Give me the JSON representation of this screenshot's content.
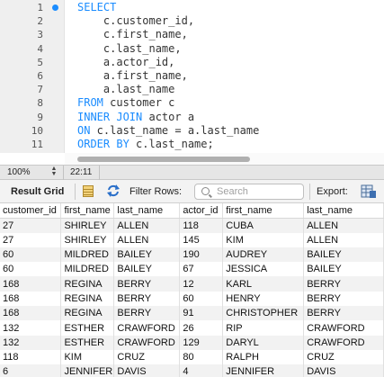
{
  "editor": {
    "lines": [
      {
        "num": "1",
        "segments": [
          {
            "text": "SELECT",
            "kw": true
          }
        ]
      },
      {
        "num": "2",
        "segments": [
          {
            "text": "    c.customer_id,",
            "kw": false
          }
        ]
      },
      {
        "num": "3",
        "segments": [
          {
            "text": "    c.first_name,",
            "kw": false
          }
        ]
      },
      {
        "num": "4",
        "segments": [
          {
            "text": "    c.last_name,",
            "kw": false
          }
        ]
      },
      {
        "num": "5",
        "segments": [
          {
            "text": "    a.actor_id,",
            "kw": false
          }
        ]
      },
      {
        "num": "6",
        "segments": [
          {
            "text": "    a.first_name,",
            "kw": false
          }
        ]
      },
      {
        "num": "7",
        "segments": [
          {
            "text": "    a.last_name",
            "kw": false
          }
        ]
      },
      {
        "num": "8",
        "segments": [
          {
            "text": "FROM",
            "kw": true
          },
          {
            "text": " customer c",
            "kw": false
          }
        ]
      },
      {
        "num": "9",
        "segments": [
          {
            "text": "INNER JOIN",
            "kw": true
          },
          {
            "text": " actor a",
            "kw": false
          }
        ]
      },
      {
        "num": "10",
        "segments": [
          {
            "text": "ON",
            "kw": true
          },
          {
            "text": " c.last_name = a.last_name",
            "kw": false
          }
        ]
      },
      {
        "num": "11",
        "segments": [
          {
            "text": "ORDER BY",
            "kw": true
          },
          {
            "text": " c.last_name;",
            "kw": false
          }
        ]
      }
    ]
  },
  "status": {
    "zoom": "100%",
    "cursor_position": "22:11"
  },
  "toolbar": {
    "result_grid_label": "Result Grid",
    "filter_rows_label": "Filter Rows:",
    "search_placeholder": "Search",
    "export_label": "Export:"
  },
  "grid": {
    "columns": [
      "customer_id",
      "first_name",
      "last_name",
      "actor_id",
      "first_name",
      "last_name"
    ],
    "rows": [
      [
        "27",
        "SHIRLEY",
        "ALLEN",
        "118",
        "CUBA",
        "ALLEN"
      ],
      [
        "27",
        "SHIRLEY",
        "ALLEN",
        "145",
        "KIM",
        "ALLEN"
      ],
      [
        "60",
        "MILDRED",
        "BAILEY",
        "190",
        "AUDREY",
        "BAILEY"
      ],
      [
        "60",
        "MILDRED",
        "BAILEY",
        "67",
        "JESSICA",
        "BAILEY"
      ],
      [
        "168",
        "REGINA",
        "BERRY",
        "12",
        "KARL",
        "BERRY"
      ],
      [
        "168",
        "REGINA",
        "BERRY",
        "60",
        "HENRY",
        "BERRY"
      ],
      [
        "168",
        "REGINA",
        "BERRY",
        "91",
        "CHRISTOPHER",
        "BERRY"
      ],
      [
        "132",
        "ESTHER",
        "CRAWFORD",
        "26",
        "RIP",
        "CRAWFORD"
      ],
      [
        "132",
        "ESTHER",
        "CRAWFORD",
        "129",
        "DARYL",
        "CRAWFORD"
      ],
      [
        "118",
        "KIM",
        "CRUZ",
        "80",
        "RALPH",
        "CRUZ"
      ],
      [
        "6",
        "JENNIFER",
        "DAVIS",
        "4",
        "JENNIFER",
        "DAVIS"
      ]
    ]
  },
  "colors": {
    "keyword": "#1a8cff",
    "breakpoint_marker": "#1a8cff",
    "alt_row": "#f2f2f2"
  },
  "icons": {
    "breakpoint": "current-statement-dot-icon",
    "zoom_stepper": "up-down-stepper-icon",
    "grid_view": "grid-view-icon",
    "refresh": "refresh-icon",
    "search": "search-icon",
    "export": "export-icon"
  }
}
